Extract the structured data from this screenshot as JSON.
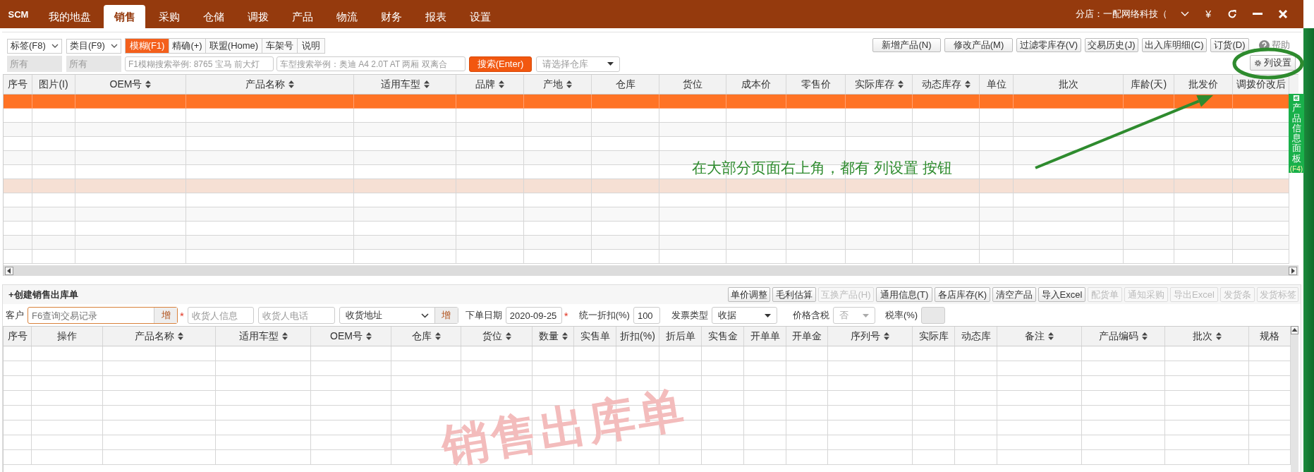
{
  "top_nav": {
    "logo": "SCM",
    "tabs": [
      {
        "label": "我的地盘",
        "selected": false
      },
      {
        "label": "销售",
        "selected": true
      },
      {
        "label": "采购",
        "selected": false
      },
      {
        "label": "仓储",
        "selected": false
      },
      {
        "label": "调拨",
        "selected": false
      },
      {
        "label": "产品",
        "selected": false
      },
      {
        "label": "物流",
        "selected": false
      },
      {
        "label": "财务",
        "selected": false
      },
      {
        "label": "报表",
        "selected": false
      },
      {
        "label": "设置",
        "selected": false
      }
    ],
    "store": "分店：一配网络科技（",
    "currency": "¥"
  },
  "filters": {
    "dropdowns": [
      {
        "label": "标签(F8)",
        "value": "所有"
      },
      {
        "label": "类目(F9)",
        "value": "所有"
      }
    ],
    "modes": [
      {
        "label": "模糊(F1)",
        "selected": true
      },
      {
        "label": "精确(+)",
        "selected": false
      },
      {
        "label": "联盟(Home)",
        "selected": false
      },
      {
        "label": "车架号",
        "selected": false
      },
      {
        "label": "说明",
        "selected": false
      }
    ],
    "search_inputs": [
      {
        "placeholder": "F1模糊搜索举例: 8765 宝马 前大灯"
      },
      {
        "placeholder": "车型搜索举例：奥迪 A4 2.0T AT 两厢 双离合"
      }
    ],
    "search_button": "搜索(Enter)",
    "warehouse_select": {
      "placeholder": "请选择仓库"
    }
  },
  "actions": [
    "新增产品(N)",
    "修改产品(M)",
    "过滤零库存(V)",
    "交易历史(J)",
    "出入库明细(C)",
    "订货(D)"
  ],
  "help": "帮助",
  "column_settings": "列设置",
  "product_table": {
    "columns": [
      {
        "label": "序号",
        "sortable": false
      },
      {
        "label": "图片(I)",
        "sortable": false
      },
      {
        "label": "OEM号",
        "sortable": true
      },
      {
        "label": "产品名称",
        "sortable": true
      },
      {
        "label": "适用车型",
        "sortable": true
      },
      {
        "label": "品牌",
        "sortable": true
      },
      {
        "label": "产地",
        "sortable": true
      },
      {
        "label": "仓库",
        "sortable": false
      },
      {
        "label": "货位",
        "sortable": false
      },
      {
        "label": "成本价",
        "sortable": false
      },
      {
        "label": "零售价",
        "sortable": false
      },
      {
        "label": "实际库存",
        "sortable": true
      },
      {
        "label": "动态库存",
        "sortable": true
      },
      {
        "label": "单位",
        "sortable": false
      },
      {
        "label": "批次",
        "sortable": false
      },
      {
        "label": "库龄(天)",
        "sortable": false
      },
      {
        "label": "批发价",
        "sortable": false
      },
      {
        "label": "调拨价改后",
        "sortable": false
      }
    ],
    "rows": [
      {
        "selected": true,
        "hovered": false
      },
      {
        "selected": false,
        "hovered": false
      },
      {
        "selected": false,
        "hovered": false
      },
      {
        "selected": false,
        "hovered": false
      },
      {
        "selected": false,
        "hovered": false
      },
      {
        "selected": false,
        "hovered": false
      },
      {
        "selected": false,
        "hovered": true
      },
      {
        "selected": false,
        "hovered": false
      },
      {
        "selected": false,
        "hovered": false
      },
      {
        "selected": false,
        "hovered": false
      },
      {
        "selected": false,
        "hovered": false
      },
      {
        "selected": false,
        "hovered": false
      }
    ]
  },
  "side_panel": {
    "title": "产品信息面板",
    "key": "(F4)"
  },
  "annotation": {
    "text": "在大部分页面右上角，都有 列设置 按钮"
  },
  "order": {
    "title": "+创建销售出库单",
    "buttons": [
      {
        "label": "单价调整",
        "disabled": false
      },
      {
        "label": "毛利估算",
        "disabled": false
      },
      {
        "label": "互换产品(H)",
        "disabled": true
      },
      {
        "label": "通用信息(T)",
        "disabled": false
      },
      {
        "label": "各店库存(K)",
        "disabled": false
      },
      {
        "label": "清空产品",
        "disabled": false
      },
      {
        "label": "导入Excel",
        "disabled": false
      },
      {
        "label": "配货单",
        "disabled": true
      },
      {
        "label": "通知采购",
        "disabled": true
      },
      {
        "label": "导出Excel",
        "disabled": true
      },
      {
        "label": "发货条",
        "disabled": true
      },
      {
        "label": "发货标签",
        "disabled": true
      }
    ],
    "form": {
      "customer": {
        "label": "客户",
        "placeholder": "F6查询交易记录",
        "add_button": "增",
        "required_mark": "*"
      },
      "receiver_info": {
        "placeholder": "收货人信息"
      },
      "receiver_phone": {
        "placeholder": "收货人电话"
      },
      "address": {
        "value": "收货地址",
        "add_button": "增"
      },
      "order_date": {
        "label": "下单日期",
        "value": "2020-09-25",
        "required_mark": "*"
      },
      "discount": {
        "label": "统一折扣(%)",
        "value": "100"
      },
      "invoice_type": {
        "label": "发票类型",
        "value": "收据"
      },
      "tax_included": {
        "label": "价格含税",
        "value": "否",
        "disabled": true
      },
      "tax_rate": {
        "label": "税率(%)",
        "disabled": true
      }
    },
    "table": {
      "columns": [
        {
          "label": "序号",
          "sortable": false
        },
        {
          "label": "操作",
          "sortable": false
        },
        {
          "label": "产品名称",
          "sortable": true
        },
        {
          "label": "适用车型",
          "sortable": true
        },
        {
          "label": "OEM号",
          "sortable": true
        },
        {
          "label": "仓库",
          "sortable": true
        },
        {
          "label": "货位",
          "sortable": true
        },
        {
          "label": "数量",
          "sortable": true
        },
        {
          "label": "实售单",
          "sortable": false
        },
        {
          "label": "折扣(%)",
          "sortable": false
        },
        {
          "label": "折后单",
          "sortable": false
        },
        {
          "label": "实售金",
          "sortable": false
        },
        {
          "label": "开单单",
          "sortable": false
        },
        {
          "label": "开单金",
          "sortable": false
        },
        {
          "label": "序列号",
          "sortable": true
        },
        {
          "label": "实际库",
          "sortable": false
        },
        {
          "label": "动态库",
          "sortable": false
        },
        {
          "label": "备注",
          "sortable": true
        },
        {
          "label": "产品编码",
          "sortable": true
        },
        {
          "label": "批次",
          "sortable": true
        },
        {
          "label": "规格",
          "sortable": false
        }
      ],
      "empty_text": "销售出库单"
    }
  }
}
